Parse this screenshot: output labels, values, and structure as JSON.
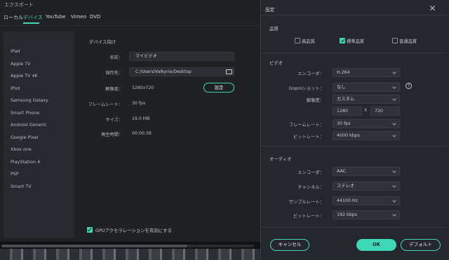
{
  "window": {
    "title": "エクスポート"
  },
  "tabs": [
    {
      "label": "ローカル"
    },
    {
      "label": "デバイス"
    },
    {
      "label": "YouTube"
    },
    {
      "label": "Vimeo"
    },
    {
      "label": "DVD"
    }
  ],
  "devices": [
    "iPhone",
    "iPad",
    "Apple TV",
    "Apple TV 4K",
    "iPod",
    "Samsung Galaxy",
    "Smart Phone",
    "Android Generic",
    "Google Pixel",
    "Xbox one",
    "PlayStation 4",
    "PSP",
    "Smart TV"
  ],
  "selected_device": "iPhone",
  "form": {
    "title": "デバイス向け",
    "name_label": "名前：",
    "name_value": "マイビデオ",
    "save_label": "保存先：",
    "save_value": "C:/Users/Valkyrie/Desktop",
    "resolution_label": "解像度：",
    "resolution_value": "1280x720",
    "settings_button": "設定",
    "framerate_label": "フレームレート：",
    "framerate_value": "30 fps",
    "size_label": "サイズ：",
    "size_value": "19.0 MB",
    "duration_label": "再生時間：",
    "duration_value": "00:00:38",
    "gpu_label": "GPUアクセラレーションを有効にする"
  },
  "dialog": {
    "title": "設定",
    "quality_section": "品質",
    "quality_options": [
      {
        "label": "高品質",
        "checked": false
      },
      {
        "label": "標準品質",
        "checked": true
      },
      {
        "label": "普通品質",
        "checked": false
      }
    ],
    "video_section": "ビデオ",
    "video": {
      "encoder_label": "エンコーダ：",
      "encoder_value": "H.264",
      "gopro_label": "Goproショット：",
      "gopro_value": "なし",
      "resolution_label": "解像度：",
      "resolution_value": "カスタム",
      "width": "1280",
      "height": "720",
      "x_sep": "X",
      "framerate_label": "フレームレート：",
      "framerate_value": "30 fps",
      "bitrate_label": "ビットレート：",
      "bitrate_value": "4000 kbps"
    },
    "audio_section": "オーディオ",
    "audio": {
      "encoder_label": "エンコーダ：",
      "encoder_value": "AAC",
      "channel_label": "チャンネル：",
      "channel_value": "ステレオ",
      "samplerate_label": "サンプルレート：",
      "samplerate_value": "44100 Hz",
      "bitrate_label": "ビットレート：",
      "bitrate_value": "192 kbps"
    },
    "cancel_button": "キャンセル",
    "ok_button": "OK",
    "default_button": "デフォルト",
    "help_icon": "?"
  },
  "colors": {
    "accent": "#3fd8b6",
    "background": "#1f2125",
    "dialog": "#25272c"
  }
}
